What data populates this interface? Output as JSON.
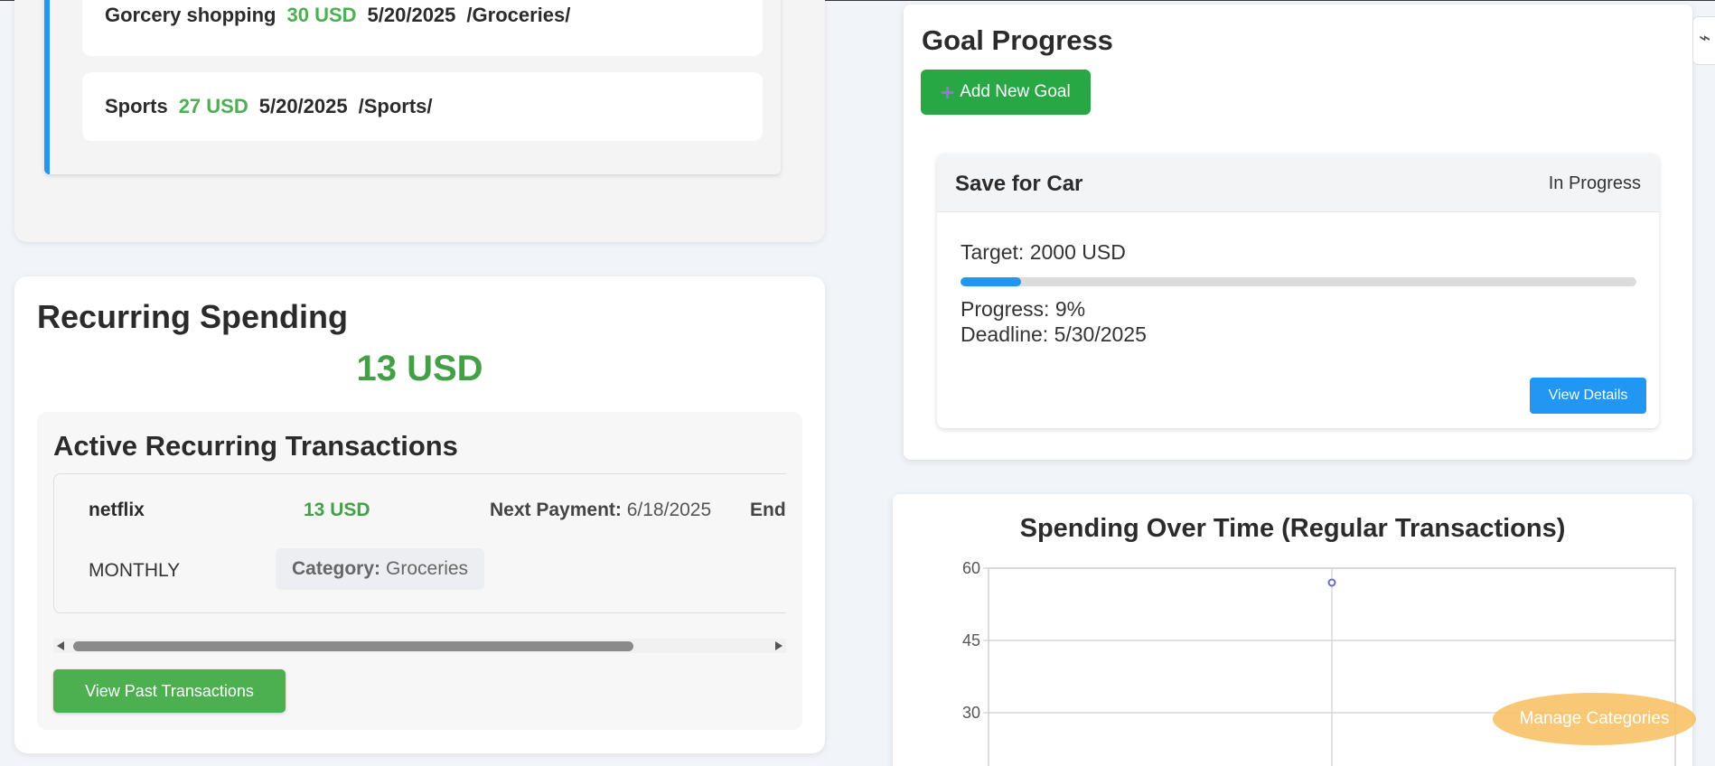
{
  "transactions": [
    {
      "name": "Gorcery shopping",
      "amount": "30 USD",
      "date": "5/20/2025",
      "category": "/Groceries/"
    },
    {
      "name": "Sports",
      "amount": "27 USD",
      "date": "5/20/2025",
      "category": "/Sports/"
    }
  ],
  "recurring": {
    "title": "Recurring Spending",
    "total": "13 USD",
    "active_title": "Active Recurring Transactions",
    "items": [
      {
        "name": "netflix",
        "amount": "13 USD",
        "next_label": "Next Payment:",
        "next_value": "6/18/2025",
        "end_label": "End",
        "frequency": "MONTHLY",
        "category_label": "Category:",
        "category_value": "Groceries"
      }
    ],
    "past_button": "View Past Transactions"
  },
  "goals": {
    "title": "Goal Progress",
    "add_button": "Add New Goal",
    "items": [
      {
        "name": "Save for Car",
        "status": "In Progress",
        "target": "Target: 2000 USD",
        "progress_text": "Progress: 9%",
        "progress_fraction": 0.09,
        "deadline": "Deadline: 5/30/2025",
        "view_button": "View Details"
      }
    ]
  },
  "manage_button": "Manage Categories",
  "colors": {
    "accent_blue": "#2196f3",
    "green": "#4caf50",
    "orange": "#f7be5f"
  },
  "chart_data": {
    "type": "line",
    "title": "Spending Over Time (Regular Transactions)",
    "y_ticks": [
      60,
      45,
      30
    ],
    "series": [
      {
        "values": [
          57
        ]
      }
    ],
    "grid": true
  }
}
